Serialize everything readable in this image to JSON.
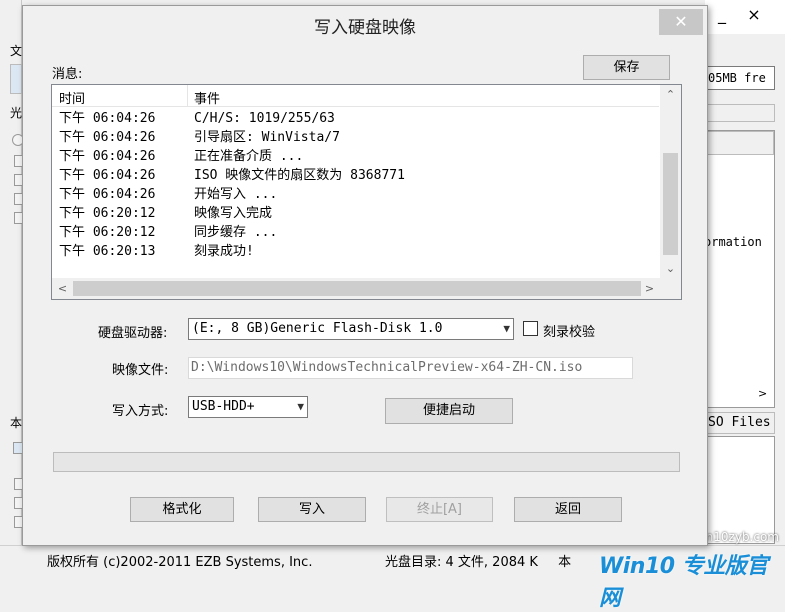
{
  "background_app": {
    "capacity_text": "05MB fre",
    "info_text": "ormation",
    "iso_files_tab": "SO Files",
    "minimize_glyph": "_",
    "close_glyph": "×",
    "left_strip_chars": [
      "文",
      "光",
      "本"
    ]
  },
  "status_bar": {
    "copyright": "版权所有 (c)2002-2011 EZB Systems, Inc.",
    "cd_dir": "光盘目录: 4 文件, 2084 K",
    "local": "本"
  },
  "watermark": {
    "logo": "Win10 专业版官网",
    "url": "win10zyb.com"
  },
  "dialog": {
    "title": "写入硬盘映像",
    "close_glyph": "✕",
    "messages_label": "消息:",
    "save_button": "保存",
    "columns": {
      "time": "时间",
      "event": "事件"
    },
    "log": [
      {
        "time": "下午 06:04:26",
        "event": "C/H/S: 1019/255/63"
      },
      {
        "time": "下午 06:04:26",
        "event": "引导扇区: WinVista/7"
      },
      {
        "time": "下午 06:04:26",
        "event": "正在准备介质 ..."
      },
      {
        "time": "下午 06:04:26",
        "event": "ISO 映像文件的扇区数为 8368771"
      },
      {
        "time": "下午 06:04:26",
        "event": "开始写入 ..."
      },
      {
        "time": "下午 06:20:12",
        "event": "映像写入完成"
      },
      {
        "time": "下午 06:20:12",
        "event": "同步缓存 ..."
      },
      {
        "time": "下午 06:20:13",
        "event": "刻录成功!"
      }
    ],
    "drive_label": "硬盘驱动器:",
    "drive_value": "(E:, 8 GB)Generic Flash-Disk      1.0",
    "verify_label": "刻录校验",
    "verify_checked": false,
    "image_label": "映像文件:",
    "image_value": "D:\\Windows10\\WindowsTechnicalPreview-x64-ZH-CN.iso",
    "write_method_label": "写入方式:",
    "write_method_value": "USB-HDD+",
    "quick_boot_button": "便捷启动",
    "progress": 0,
    "format_button": "格式化",
    "write_button": "写入",
    "stop_button": "终止[A]",
    "back_button": "返回"
  }
}
